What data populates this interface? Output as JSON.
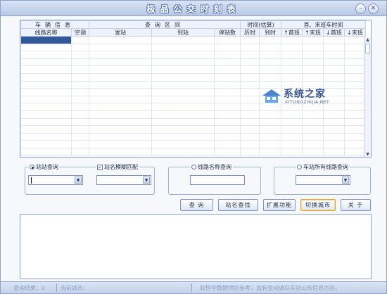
{
  "window": {
    "title": "极品公交时刻表",
    "minimize_icon": "minimize-icon",
    "close_icon": "close-icon"
  },
  "table": {
    "group_headers": [
      "车辆信息",
      "查询区间",
      "时间(估算)",
      "首、末班车时间"
    ],
    "columns": [
      "线路名称",
      "空调",
      "发站",
      "到站",
      "停站数",
      "历时",
      "到时",
      "↑首班",
      "↑末班",
      "↓首班",
      "↓末班"
    ],
    "rows": []
  },
  "watermark": {
    "text": "系统之家",
    "subtext": "XITONGZHIJIA.NET"
  },
  "search_modes": {
    "station_to_station": {
      "label": "站站查询",
      "selected": true,
      "value": ""
    },
    "fuzzy_match": {
      "label": "站名模糊匹配",
      "checked": true,
      "value": ""
    },
    "line_name": {
      "label": "线路名称查询",
      "selected": false,
      "value": ""
    },
    "station_lines": {
      "label": "车站所有线路查询",
      "selected": false,
      "value": ""
    }
  },
  "buttons": {
    "query": "查 询",
    "station_search": "站名查找",
    "extensions": "扩展功能",
    "switch_city": "切换城市",
    "about": "关 于"
  },
  "status": {
    "result": "查询结果：0",
    "current_city": "当前城市：",
    "notice": "软件中数据供您参考，如有变动请以车站公布信息为准。"
  },
  "colors": {
    "accent": "#33599b",
    "title_outline": "#5f7bb0",
    "border": "#8ea3c8",
    "active_button_border": "#e1a73a"
  }
}
